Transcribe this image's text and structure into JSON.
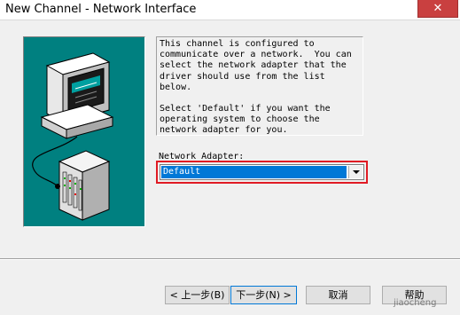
{
  "window": {
    "title": "New Channel - Network Interface",
    "close_label": "✕"
  },
  "illustration": {
    "description_icon": "pc-to-network-device-icon"
  },
  "description": {
    "para1": "This channel is configured to communicate over a network.  You can select the network adapter that the driver should use from the list below.",
    "para2": "Select 'Default' if you want the operating system to choose the network adapter for you."
  },
  "network_adapter": {
    "label": "Network Adapter:",
    "selected": "Default"
  },
  "buttons": {
    "back": "< 上一步(B)",
    "next": "下一步(N) >",
    "cancel": "取消",
    "help": "帮助"
  },
  "watermark": "jiaocheng"
}
